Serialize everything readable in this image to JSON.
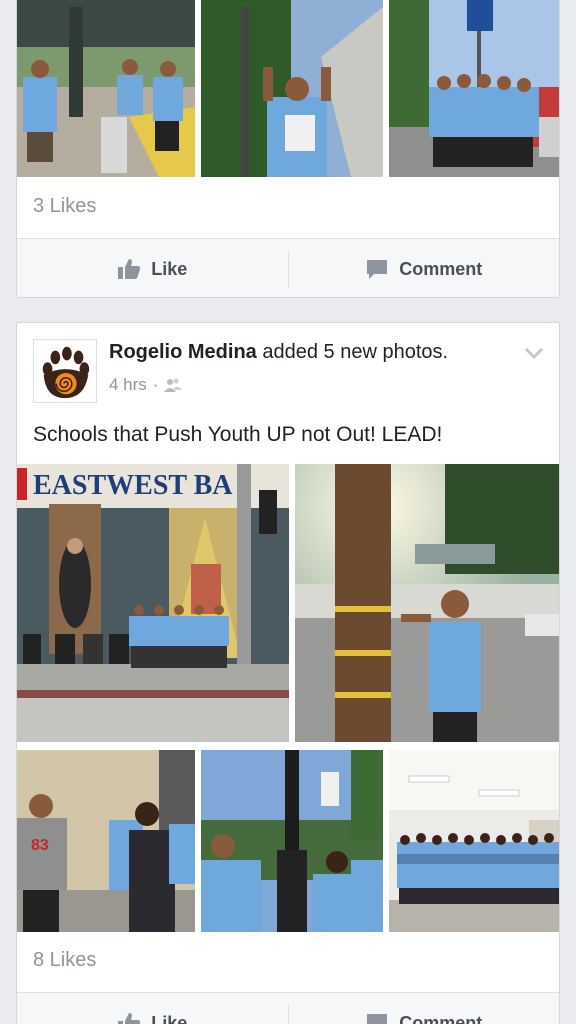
{
  "post1": {
    "likes": "3 Likes",
    "like_label": "Like",
    "comment_label": "Comment"
  },
  "post2": {
    "author": "Rogelio Medina",
    "action": "added 5 new photos.",
    "time": "4 hrs",
    "separator": "·",
    "privacy_icon": "friends-icon",
    "text": "Schools that Push Youth UP not Out! LEAD!",
    "photo_sign": "EASTWEST BA",
    "likes": "8 Likes",
    "like_label": "Like",
    "comment_label": "Comment"
  },
  "colors": {
    "background": "#e9ebee",
    "shirt_blue": "#6fa8dc",
    "meta_gray": "#90949c"
  }
}
